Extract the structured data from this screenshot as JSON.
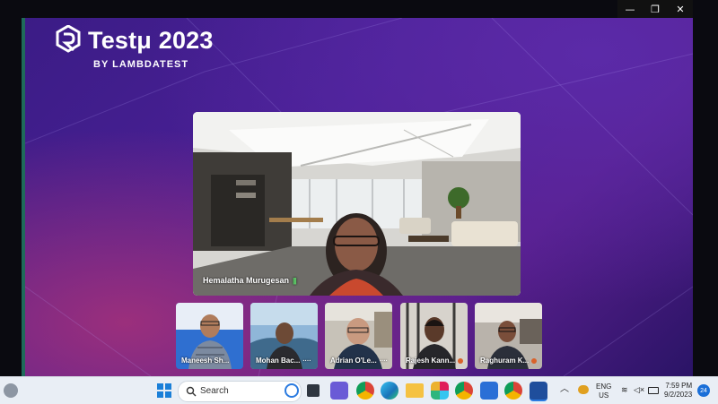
{
  "window_controls": {
    "minimize": "—",
    "restore": "❐",
    "close": "✕"
  },
  "event": {
    "title": "Testμ 2023",
    "subtitle": "BY LAMBDATEST"
  },
  "main_speaker": {
    "name": "Hemalatha Murugesan",
    "audio_indicator": "|||"
  },
  "participants": [
    {
      "name": "Maneesh Sh..."
    },
    {
      "name": "Mohan Bac...",
      "extra": "····"
    },
    {
      "name": "Adrian O'Le...",
      "extra": "····"
    },
    {
      "name": "Rajesh Kann..."
    },
    {
      "name": "Raghuram K..."
    }
  ],
  "taskbar": {
    "search_placeholder": "Search",
    "language": "ENG",
    "region": "US",
    "time": "7:59 PM",
    "date": "9/2/2023",
    "notification_count": "24"
  }
}
